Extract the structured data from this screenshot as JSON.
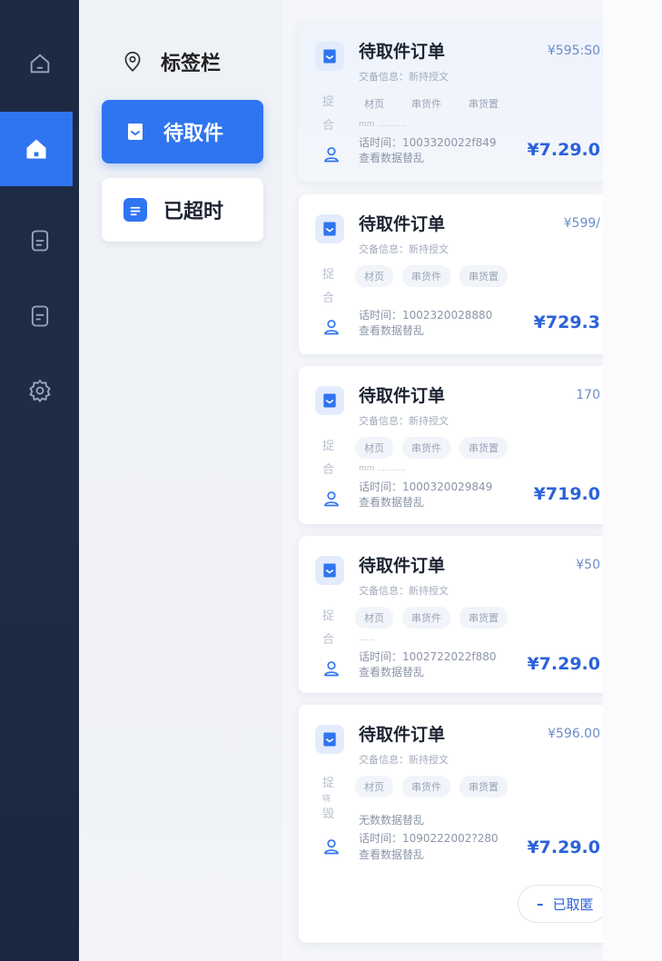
{
  "subnav": {
    "header": "标签栏",
    "items": [
      {
        "label": "待取件"
      },
      {
        "label": "已超时"
      }
    ]
  },
  "cards": [
    {
      "title": "待取件订单",
      "price_top": "¥595:S0",
      "sub": "交备信息：新持授文",
      "side": [
        "捉",
        "合"
      ],
      "tags": [
        "材页",
        "串货件",
        "串货置"
      ],
      "dots": "mm ...........",
      "time": "话时间：1003320022f849",
      "link": "查看数据替乱",
      "price": "¥7.29.0"
    },
    {
      "title": "待取件订单",
      "price_top": "¥599/",
      "sub": "交备信息：新持授文",
      "side": [
        "捉",
        "合"
      ],
      "tags": [
        "材页",
        "串货件",
        "串货置"
      ],
      "dots": "",
      "time": "话时间：1002320028880",
      "link": "查看数据替乱",
      "price": "¥729.3"
    },
    {
      "title": "待取件订单",
      "price_top": "170",
      "sub": "交备信息：新持授文",
      "side": [
        "捉",
        "合"
      ],
      "tags": [
        "材页",
        "串货件",
        "串货置"
      ],
      "dots": "mm ...........",
      "time": "话时间：1000320029849",
      "link": "查看数据替乱",
      "price": "¥719.0"
    },
    {
      "title": "待取件订单",
      "price_top": "¥50",
      "sub": "交备信息：新持授文",
      "side": [
        "捉",
        "合"
      ],
      "tags": [
        "材页",
        "串货件",
        "串货置"
      ],
      "dots": "......",
      "time": "话时间：1002722022f880",
      "link": "查看数据替乱",
      "price": "¥7.29.0"
    },
    {
      "title": "待取件订单",
      "price_top": "¥596.00",
      "sub": "交备信息：新持授文",
      "side": [
        "捉",
        "晓",
        "毁"
      ],
      "tags": [
        "材页",
        "串货件",
        "串货置"
      ],
      "dots": "无数数据替乱",
      "time": "话时间：1090222002?280",
      "link": "查看数据替乱",
      "price": "¥7.29.0"
    }
  ],
  "footer_button": "已取匿",
  "colors": {
    "accent": "#2f74f0",
    "rail": "#1d2a44",
    "price": "#2b62d9"
  }
}
